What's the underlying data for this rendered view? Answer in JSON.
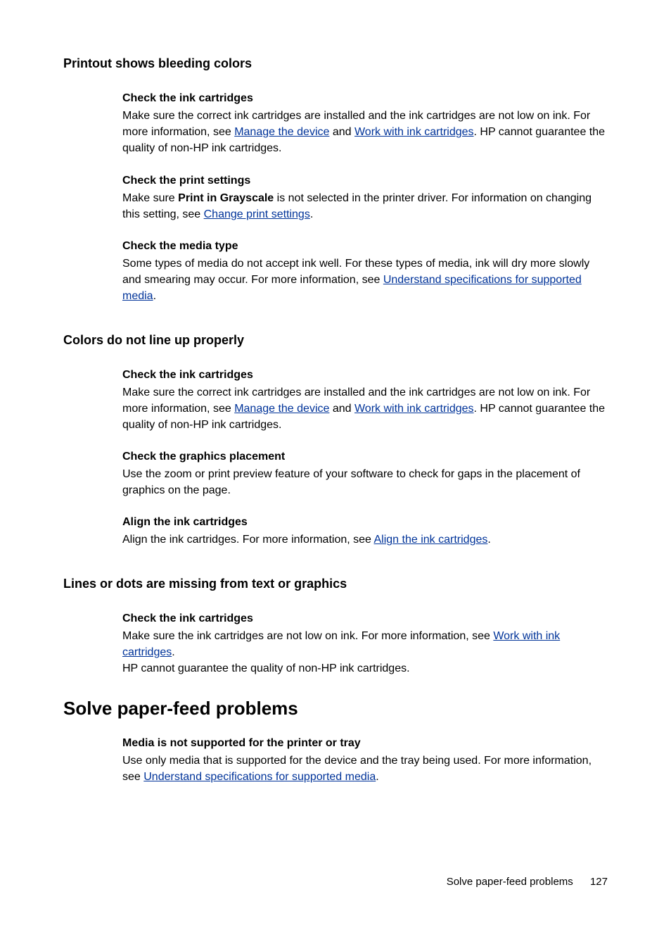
{
  "section1": {
    "title": "Printout shows bleeding colors",
    "b1": {
      "h": "Check the ink cartridges",
      "t1": "Make sure the correct ink cartridges are installed and the ink cartridges are not low on ink. For more information, see ",
      "l1": "Manage the device",
      "t2": " and ",
      "l2": "Work with ink cartridges",
      "t3": ". HP cannot guarantee the quality of non-HP ink cartridges."
    },
    "b2": {
      "h": "Check the print settings",
      "t1": "Make sure ",
      "bold": "Print in Grayscale",
      "t2": " is not selected in the printer driver. For information on changing this setting, see ",
      "l1": "Change print settings",
      "t3": "."
    },
    "b3": {
      "h": "Check the media type",
      "t1": "Some types of media do not accept ink well. For these types of media, ink will dry more slowly and smearing may occur. For more information, see ",
      "l1": "Understand specifications for supported media",
      "t2": "."
    }
  },
  "section2": {
    "title": "Colors do not line up properly",
    "b1": {
      "h": "Check the ink cartridges",
      "t1": "Make sure the correct ink cartridges are installed and the ink cartridges are not low on ink. For more information, see ",
      "l1": "Manage the device",
      "t2": " and ",
      "l2": "Work with ink cartridges",
      "t3": ". HP cannot guarantee the quality of non-HP ink cartridges."
    },
    "b2": {
      "h": "Check the graphics placement",
      "t1": "Use the zoom or print preview feature of your software to check for gaps in the placement of graphics on the page."
    },
    "b3": {
      "h": "Align the ink cartridges",
      "t1": "Align the ink cartridges. For more information, see ",
      "l1": "Align the ink cartridges",
      "t2": "."
    }
  },
  "section3": {
    "title": "Lines or dots are missing from text or graphics",
    "b1": {
      "h": "Check the ink cartridges",
      "t1": "Make sure the ink cartridges are not low on ink. For more information, see ",
      "l1": "Work with ink cartridges",
      "t2": ".",
      "t3": "HP cannot guarantee the quality of non-HP ink cartridges."
    }
  },
  "section4": {
    "title": "Solve paper-feed problems",
    "b1": {
      "h": "Media is not supported for the printer or tray",
      "t1": "Use only media that is supported for the device and the tray being used. For more information, see ",
      "l1": "Understand specifications for supported media",
      "t2": "."
    }
  },
  "footer": {
    "text": "Solve paper-feed problems",
    "page": "127"
  }
}
